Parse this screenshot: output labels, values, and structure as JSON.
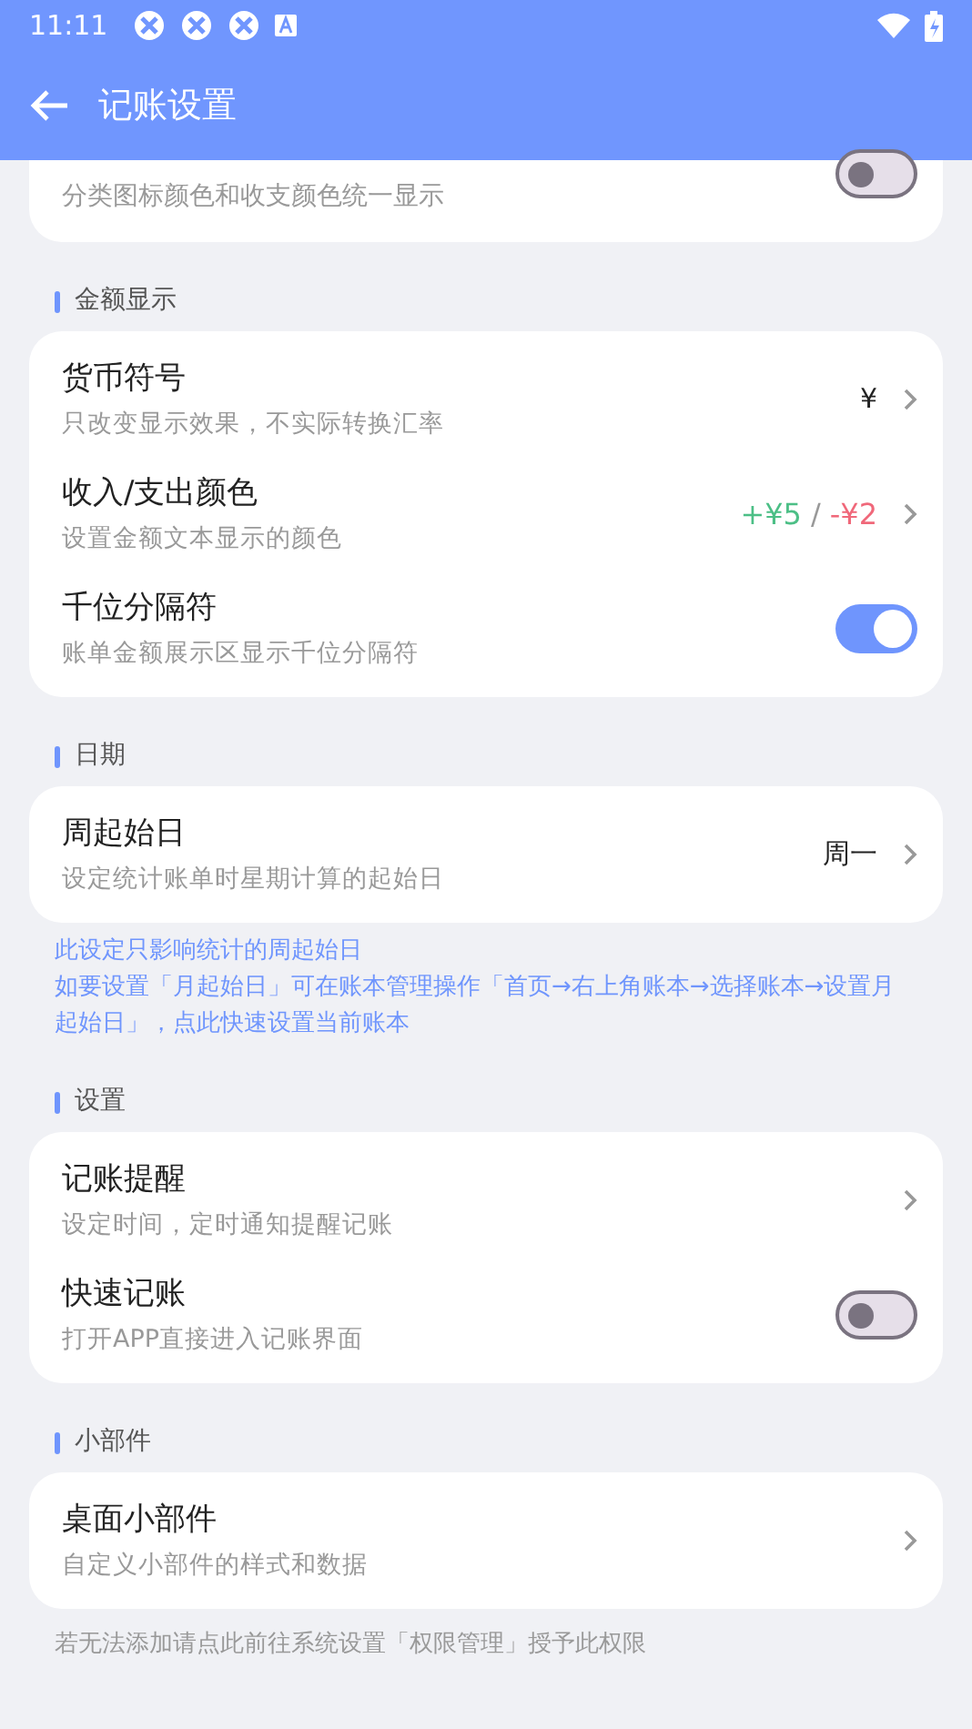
{
  "status_bar": {
    "time": "11:11"
  },
  "header": {
    "title": "记账设置"
  },
  "top_card": {
    "subtitle": "分类图标颜色和收支颜色统一显示",
    "on": false
  },
  "sections": [
    {
      "title": "金额显示",
      "rows": [
        {
          "kind": "value",
          "title": "货币符号",
          "subtitle": "只改变显示效果，不实际转换汇率",
          "value": "¥"
        },
        {
          "kind": "colors",
          "title": "收入/支出颜色",
          "subtitle": "设置金额文本显示的颜色",
          "income": "+¥5",
          "separator": "/",
          "expense": "-¥2"
        },
        {
          "kind": "toggle",
          "title": "千位分隔符",
          "subtitle": "账单金额展示区显示千位分隔符",
          "on": true
        }
      ]
    },
    {
      "title": "日期",
      "rows": [
        {
          "kind": "value",
          "title": "周起始日",
          "subtitle": "设定统计账单时星期计算的起始日",
          "value": "周一"
        }
      ],
      "note": [
        "此设定只影响统计的周起始日",
        "如要设置「月起始日」可在账本管理操作「首页→右上角账本→选择账本→设置月起始日」，点此快速设置当前账本"
      ]
    },
    {
      "title": "设置",
      "rows": [
        {
          "kind": "link",
          "title": "记账提醒",
          "subtitle": "设定时间，定时通知提醒记账"
        },
        {
          "kind": "toggle",
          "title": "快速记账",
          "subtitle": "打开APP直接进入记账界面",
          "on": false
        }
      ]
    },
    {
      "title": "小部件",
      "rows": [
        {
          "kind": "link",
          "title": "桌面小部件",
          "subtitle": "自定义小部件的样式和数据"
        }
      ],
      "footer": "若无法添加请点此前往系统设置「权限管理」授予此权限"
    }
  ]
}
